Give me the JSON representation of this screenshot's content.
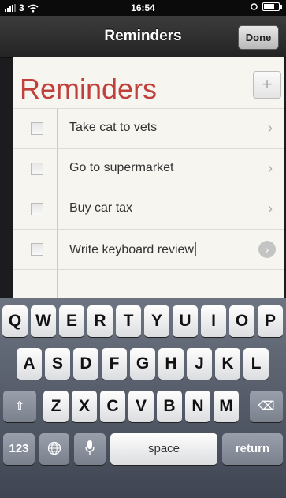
{
  "status_bar": {
    "carrier": "3",
    "time": "16:54",
    "wifi_icon": "wifi-icon",
    "battery_level": 0.8
  },
  "navbar": {
    "title": "Reminders",
    "done_label": "Done"
  },
  "list": {
    "title": "Reminders",
    "add_icon": "+",
    "items": [
      {
        "label": "Take cat to vets",
        "accessory": "chevron"
      },
      {
        "label": "Go to supermarket",
        "accessory": "chevron"
      },
      {
        "label": "Buy car tax",
        "accessory": "chevron"
      },
      {
        "label": "Write keyboard review",
        "accessory": "detail",
        "editing": true
      },
      {
        "label": "",
        "accessory": "none"
      }
    ]
  },
  "keyboard": {
    "row1": [
      "Q",
      "W",
      "E",
      "R",
      "T",
      "Y",
      "U",
      "I",
      "O",
      "P"
    ],
    "row2": [
      "A",
      "S",
      "D",
      "F",
      "G",
      "H",
      "J",
      "K",
      "L"
    ],
    "row3": [
      "Z",
      "X",
      "C",
      "V",
      "B",
      "N",
      "M"
    ],
    "shift_icon": "⇧",
    "delete_icon": "⌫",
    "numbers_label": "123",
    "globe_icon": "globe-icon",
    "mic_icon": "microphone-icon",
    "space_label": "space",
    "return_label": "return"
  },
  "colors": {
    "title_red": "#c0413c",
    "caret_blue": "#3b67d6"
  }
}
